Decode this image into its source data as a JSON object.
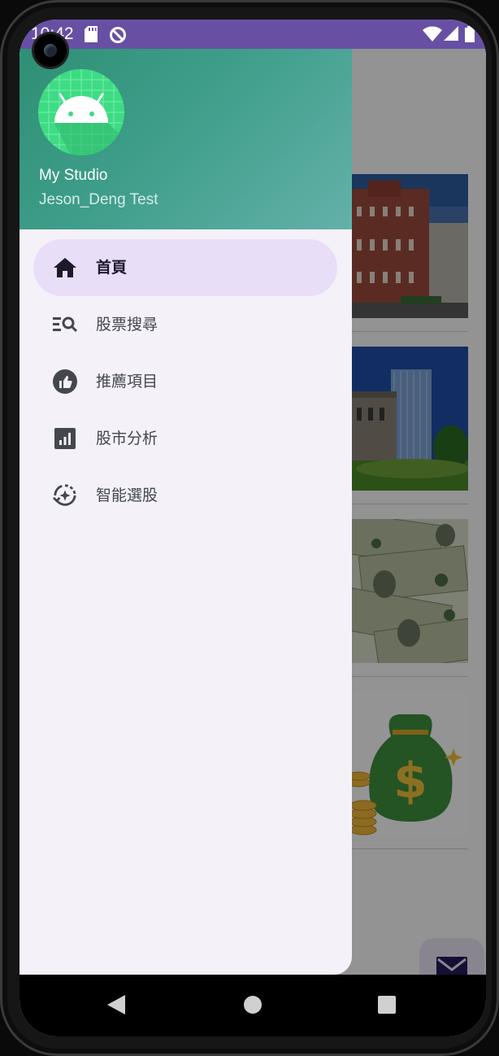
{
  "status_bar": {
    "time": "10:42",
    "color": "#6750a4",
    "icons": [
      "sd-card-icon",
      "no-disturb-icon",
      "wifi-icon",
      "signal-icon",
      "battery-icon"
    ]
  },
  "drawer": {
    "header": {
      "title": "My Studio",
      "subtitle": "Jeson_Deng Test",
      "avatar_icon": "android-icon"
    },
    "menu": [
      {
        "label": "首頁",
        "icon": "home-icon",
        "active": true
      },
      {
        "label": "股票搜尋",
        "icon": "search-list-icon",
        "active": false
      },
      {
        "label": "推薦項目",
        "icon": "thumb-up-icon",
        "active": false
      },
      {
        "label": "股市分析",
        "icon": "bar-chart-icon",
        "active": false
      },
      {
        "label": "智能選股",
        "icon": "auto-awesome-icon",
        "active": false
      }
    ]
  },
  "background": {
    "cards": [
      "building-image",
      "skyscraper-image",
      "money-image",
      "money-bag-image"
    ],
    "fab_icon": "mail-icon"
  },
  "nav_bar": {
    "buttons": [
      "back-icon",
      "home-circle-icon",
      "recents-icon"
    ]
  },
  "colors": {
    "accent": "#6750a4",
    "active_item": "#e8def8",
    "header_start": "#2f8f74",
    "header_end": "#63b1a9"
  }
}
